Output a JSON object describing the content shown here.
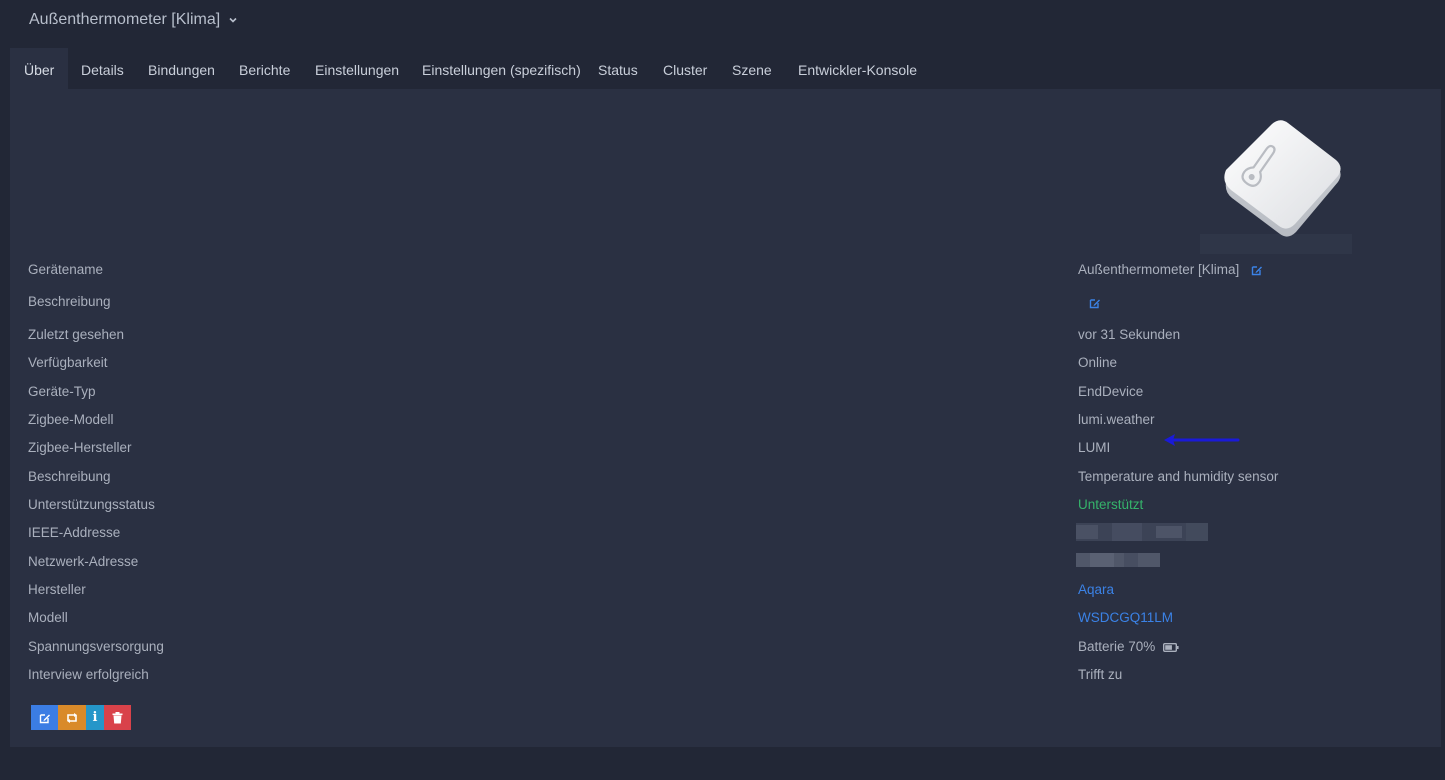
{
  "header": {
    "device_title": "Außenthermometer [Klima]"
  },
  "tabs": [
    {
      "label": "Über"
    },
    {
      "label": "Details"
    },
    {
      "label": "Bindungen"
    },
    {
      "label": "Berichte"
    },
    {
      "label": "Einstellungen"
    },
    {
      "label": "Einstellungen (spezifisch)"
    },
    {
      "label": "Status"
    },
    {
      "label": "Cluster"
    },
    {
      "label": "Szene"
    },
    {
      "label": "Entwickler-Konsole"
    }
  ],
  "active_tab": "Über",
  "details": {
    "device_name": {
      "label": "Gerätename",
      "value": "Außenthermometer [Klima]"
    },
    "description": {
      "label": "Beschreibung",
      "value": ""
    },
    "last_seen": {
      "label": "Zuletzt gesehen",
      "value": "vor 31 Sekunden"
    },
    "availability": {
      "label": "Verfügbarkeit",
      "value": "Online"
    },
    "device_type": {
      "label": "Geräte-Typ",
      "value": "EndDevice"
    },
    "zigbee_model": {
      "label": "Zigbee-Modell",
      "value": "lumi.weather"
    },
    "zigbee_manufacturer": {
      "label": "Zigbee-Hersteller",
      "value": "LUMI"
    },
    "model_description": {
      "label": "Beschreibung",
      "value": "Temperature and humidity sensor"
    },
    "support_status": {
      "label": "Unterstützungsstatus",
      "value": "Unterstützt"
    },
    "ieee_address": {
      "label": "IEEE-Addresse",
      "value": ""
    },
    "network_address": {
      "label": "Netzwerk-Adresse",
      "value": ""
    },
    "manufacturer": {
      "label": "Hersteller",
      "value": "Aqara"
    },
    "model": {
      "label": "Modell",
      "value": "WSDCGQ11LM"
    },
    "power_source": {
      "label": "Spannungsversorgung",
      "value": "Batterie 70%"
    },
    "interview_completed": {
      "label": "Interview erfolgreich",
      "value": "Trifft zu"
    }
  },
  "battery_percent": 70,
  "colors": {
    "link": "#3b82e6",
    "supported": "#35b36b",
    "edit_button": "#3b7de4",
    "reconfigure_button": "#d98a2a",
    "interview_button": "#2596c9",
    "delete_button": "#d9424a",
    "annotation_arrow": "#1a1ad8"
  },
  "actions": [
    {
      "icon": "edit-icon"
    },
    {
      "icon": "reconfigure-icon"
    },
    {
      "icon": "info-icon",
      "label": "i"
    },
    {
      "icon": "trash-icon"
    }
  ]
}
